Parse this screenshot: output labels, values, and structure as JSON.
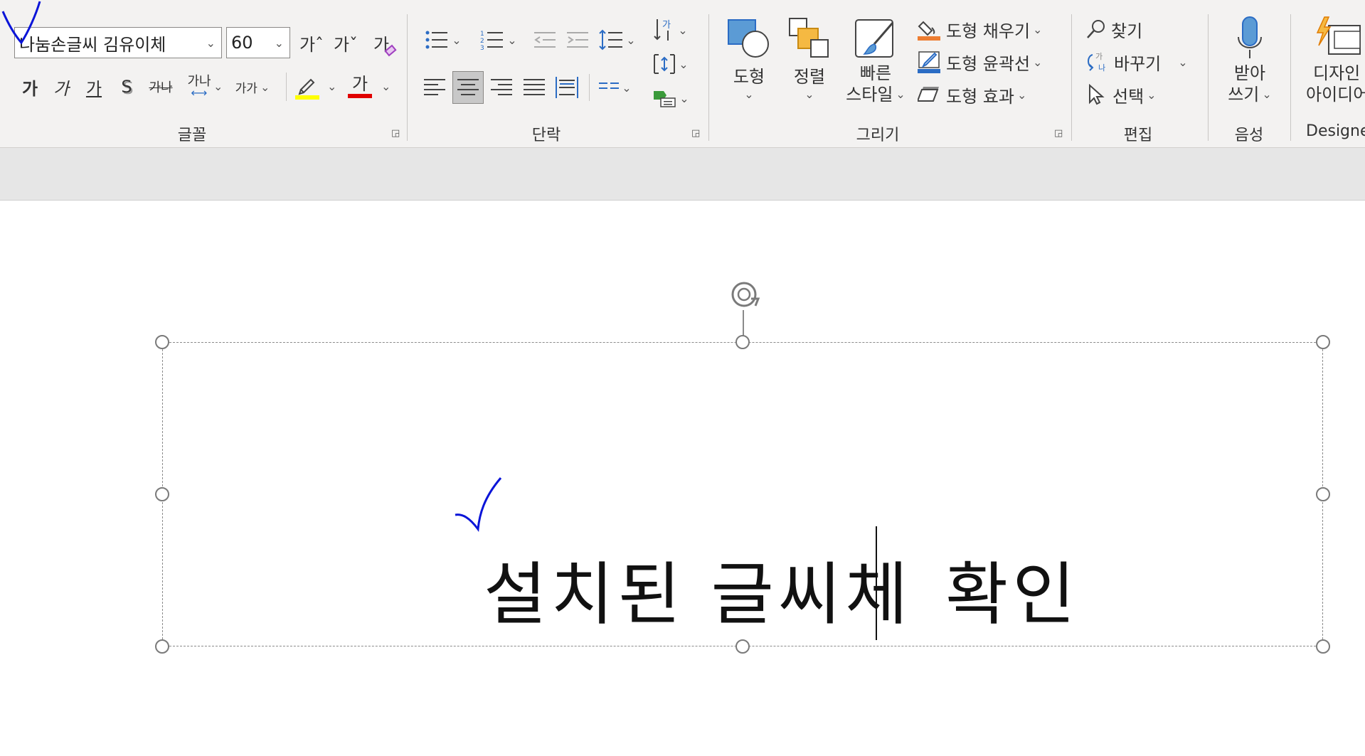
{
  "font_group": {
    "font_name": "나눔손글씨 김유이체",
    "font_size": "60",
    "grow_font": "가ˆ",
    "shrink_font": "가ˇ",
    "clear_format": "가",
    "bold": "가",
    "italic": "가",
    "underline": "가",
    "shadow": "S",
    "strike": "가나",
    "char_spacing": "가나",
    "change_case": "가가",
    "font_color": "가",
    "label": "글꼴"
  },
  "paragraph_group": {
    "label": "단락"
  },
  "drawing_group": {
    "shapes_label": "도형",
    "arrange_label": "정렬",
    "quick_styles_line1": "빠른",
    "quick_styles_line2": "스타일",
    "shape_fill": "도형 채우기",
    "shape_outline": "도형 윤곽선",
    "shape_effects": "도형 효과",
    "label": "그리기"
  },
  "editing_group": {
    "find": "찾기",
    "replace": "바꾸기",
    "select": "선택",
    "label": "편집"
  },
  "voice_group": {
    "dictate_line1": "받아",
    "dictate_line2": "쓰기",
    "label": "음성"
  },
  "designer_group": {
    "design_ideas_line1": "디자인",
    "design_ideas_line2": "아이디어",
    "label": "Designer"
  },
  "slide": {
    "text_before_caret": "설치된 글씨체 ",
    "text_after_caret": "확인"
  },
  "colors": {
    "highlight": "#ffff00",
    "font_color": "#e00000",
    "annotation_ink": "#0a14d8",
    "accent_blue": "#2b6cc4"
  }
}
